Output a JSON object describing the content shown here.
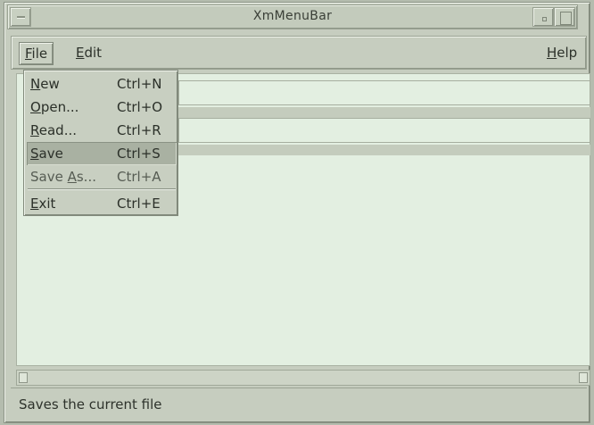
{
  "window": {
    "title": "XmMenuBar"
  },
  "menubar": {
    "items": [
      {
        "label": "File",
        "mnemonic": "F",
        "rest": "ile",
        "active": true
      },
      {
        "label": "Edit",
        "mnemonic": "E",
        "rest": "dit"
      },
      {
        "label": "Help",
        "mnemonic": "H",
        "rest": "elp"
      }
    ]
  },
  "file_menu": {
    "items": [
      {
        "label": "New",
        "mnemonic": "N",
        "rest": "ew",
        "accel": "Ctrl+N"
      },
      {
        "label": "Open...",
        "mnemonic": "O",
        "rest": "pen...",
        "accel": "Ctrl+O"
      },
      {
        "label": "Read...",
        "mnemonic": "R",
        "rest": "ead...",
        "accel": "Ctrl+R"
      },
      {
        "label": "Save",
        "mnemonic": "S",
        "rest": "ave",
        "accel": "Ctrl+S",
        "selected": true
      },
      {
        "label": "Save As...",
        "prefix": "Save ",
        "mnemonic": "A",
        "rest": "s...",
        "accel": "Ctrl+A"
      },
      {
        "label": "Exit",
        "mnemonic": "E",
        "rest": "xit",
        "accel": "Ctrl+E"
      }
    ]
  },
  "status_bar": {
    "text": "Saves the current file"
  },
  "colors": {
    "chrome": "#c6cdbf",
    "work_area": "#e3efe1",
    "menu_selected": "#a9b1a2"
  }
}
